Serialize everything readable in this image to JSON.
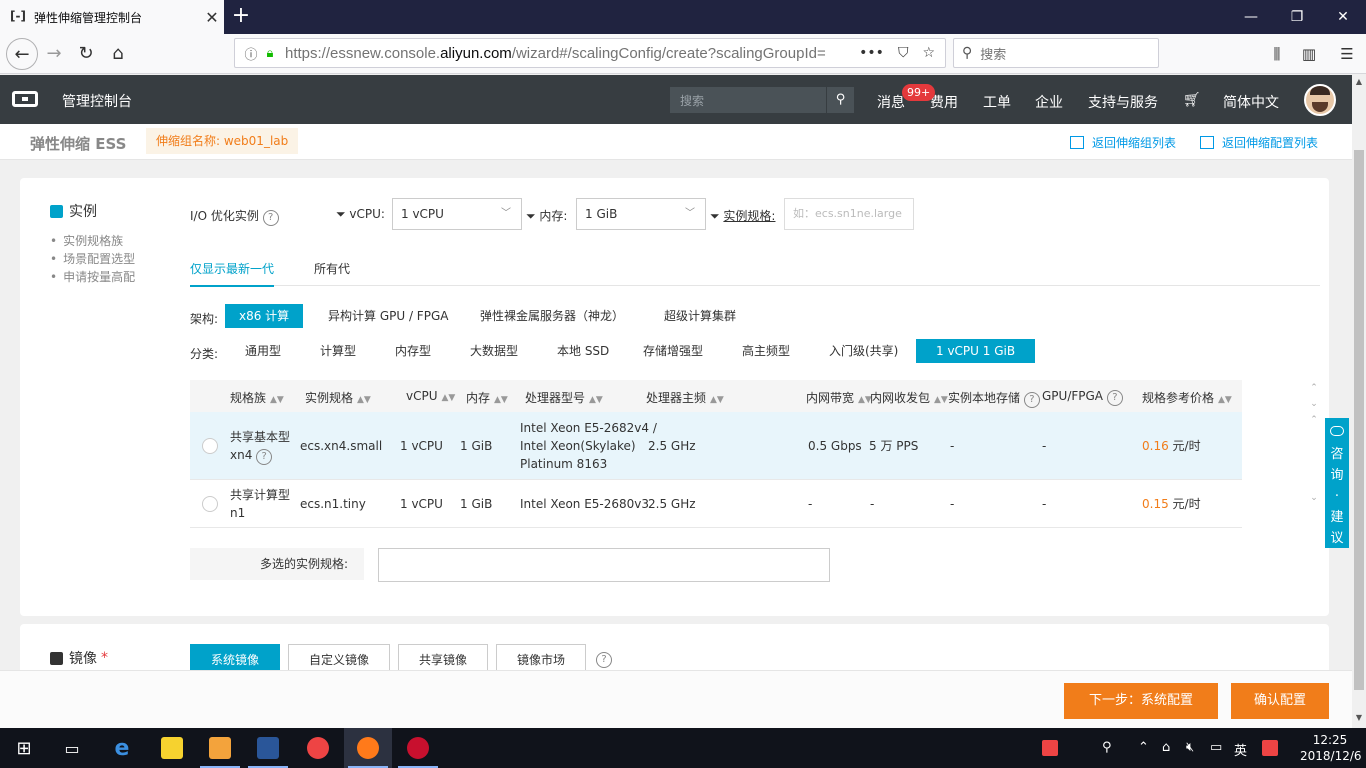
{
  "browser": {
    "tab_title": "弹性伸缩管理控制台",
    "url_prefix": "https://essnew.console.",
    "url_domain": "aliyun.com",
    "url_suffix": "/wizard#/scalingConfig/create?scalingGroupId=",
    "search_placeholder": "搜索"
  },
  "header": {
    "console": "管理控制台",
    "search_placeholder": "搜索",
    "messages": "消息",
    "messages_badge": "99+",
    "menu": [
      "费用",
      "工单",
      "企业",
      "支持与服务",
      "简体中文"
    ]
  },
  "subheader": {
    "product": "弹性伸缩 ESS",
    "group_label": "伸缩组名称: web01_lab",
    "back_group_list": "返回伸缩组列表",
    "back_config_list": "返回伸缩配置列表"
  },
  "instance": {
    "title": "实例",
    "side_links": [
      "实例规格族",
      "场景配置选型",
      "申请按量高配"
    ],
    "io_optimized": "I/O 优化实例",
    "vcpu_label": "vCPU:",
    "vcpu_value": "1 vCPU",
    "mem_label": "内存:",
    "mem_value": "1 GiB",
    "spec_label": "实例规格:",
    "spec_placeholder": "如：ecs.sn1ne.large",
    "gen_tabs": [
      "仅显示最新一代",
      "所有代"
    ],
    "arch_label": "架构:",
    "arch": [
      "x86 计算",
      "异构计算 GPU / FPGA",
      "弹性裸金属服务器（神龙）",
      "超级计算集群"
    ],
    "cat_label": "分类:",
    "categories": [
      "通用型",
      "计算型",
      "内存型",
      "大数据型",
      "本地 SSD",
      "存储增强型",
      "高主频型",
      "入门级(共享)",
      "1 vCPU 1 GiB"
    ],
    "columns": [
      "规格族",
      "实例规格",
      "vCPU",
      "内存",
      "处理器型号",
      "处理器主频",
      "内网带宽",
      "内网收发包",
      "实例本地存储",
      "GPU/FPGA",
      "规格参考价格"
    ],
    "rows": [
      {
        "family_line1": "共享基本型",
        "family_line2": "xn4",
        "spec": "ecs.xn4.small",
        "vcpu": "1 vCPU",
        "mem": "1 GiB",
        "cpu_line1": "Intel Xeon E5-2682v4 /",
        "cpu_line2": "Intel Xeon(Skylake)",
        "cpu_line3": "Platinum 8163",
        "freq": "2.5 GHz",
        "bandwidth": "0.5 Gbps",
        "pps": "5 万 PPS",
        "storage": "-",
        "gpu": "-",
        "price_num": "0.16",
        "price_unit": " 元/时"
      },
      {
        "family_line1": "共享计算型",
        "family_line2": "n1",
        "spec": "ecs.n1.tiny",
        "vcpu": "1 vCPU",
        "mem": "1 GiB",
        "cpu_line1": "Intel Xeon E5-2680v3",
        "freq": "2.5 GHz",
        "bandwidth": "-",
        "pps": "-",
        "storage": "-",
        "gpu": "-",
        "price_num": "0.15",
        "price_unit": " 元/时"
      }
    ],
    "multi_label": "多选的实例规格:"
  },
  "image": {
    "title": "镜像",
    "required_mark": "*",
    "tabs": [
      "系统镜像",
      "自定义镜像",
      "共享镜像",
      "镜像市场"
    ]
  },
  "consult": [
    "咨",
    "询",
    "·",
    "建",
    "议"
  ],
  "footer": {
    "next": "下一步：系统配置",
    "confirm": "确认配置"
  },
  "taskbar": {
    "ime": "英",
    "time": "12:25",
    "date": "2018/12/6"
  },
  "colors": {
    "accent": "#00a2ca",
    "orange": "#f17d1a",
    "header_bg": "#373d41"
  }
}
